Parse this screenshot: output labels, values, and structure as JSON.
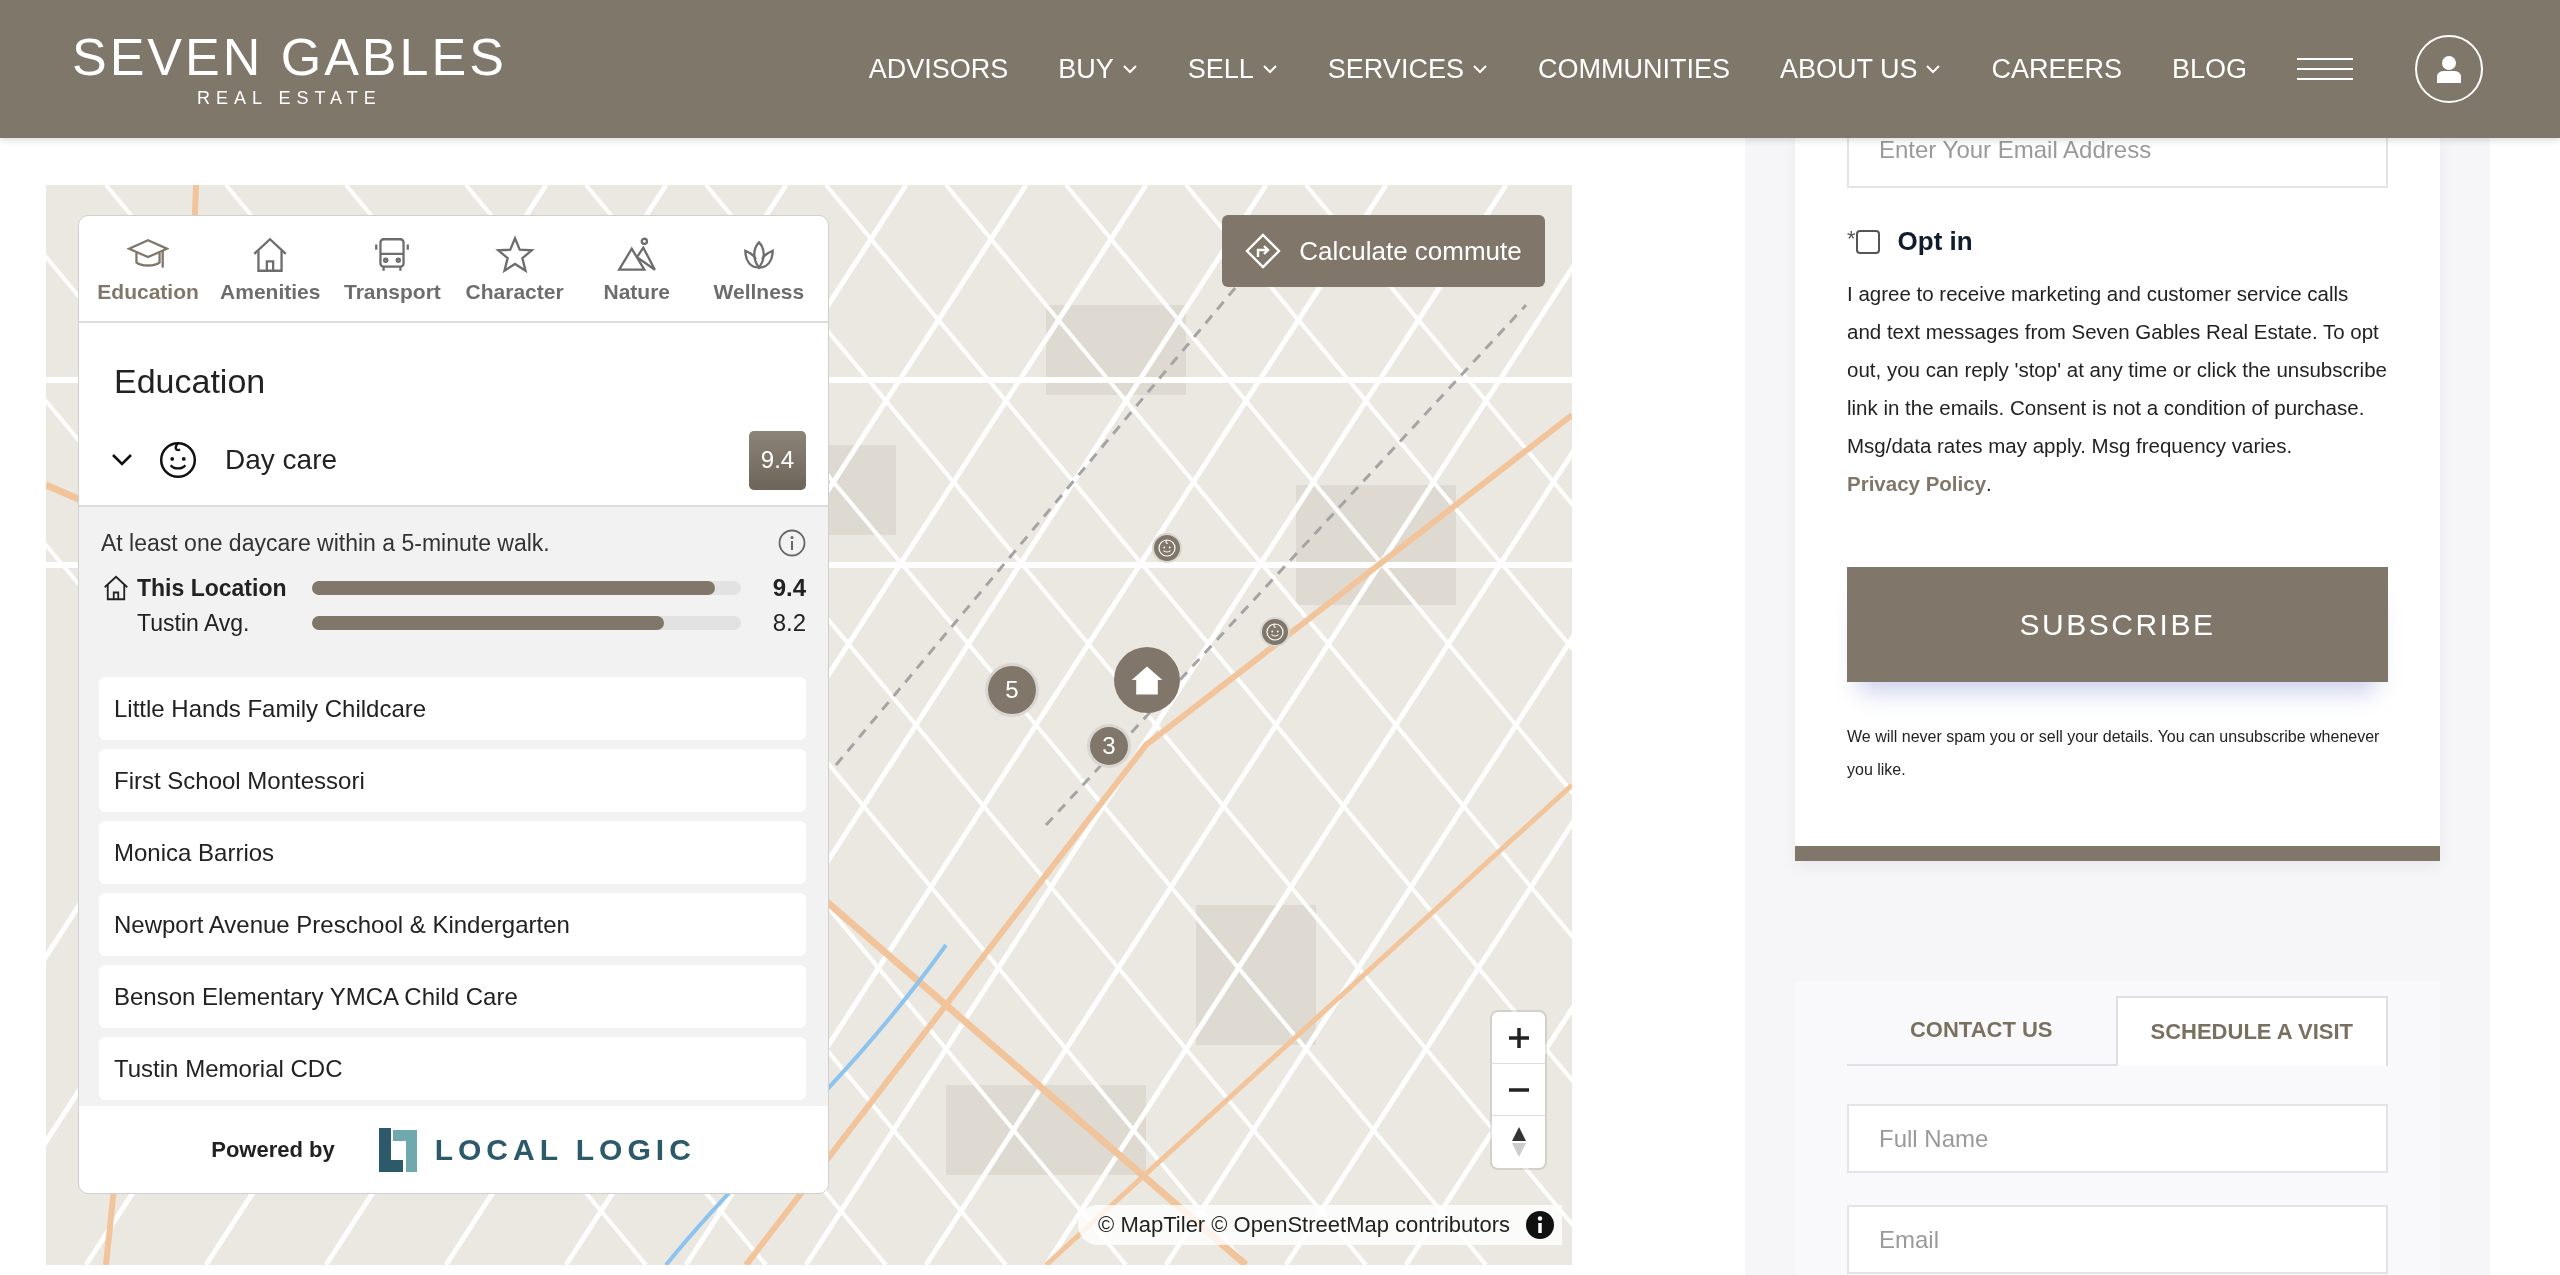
{
  "header": {
    "logo": {
      "name": "SEVEN GABLES",
      "tagline": "REAL ESTATE"
    },
    "nav": [
      {
        "label": "ADVISORS",
        "dropdown": false
      },
      {
        "label": "BUY",
        "dropdown": true
      },
      {
        "label": "SELL",
        "dropdown": true
      },
      {
        "label": "SERVICES",
        "dropdown": true
      },
      {
        "label": "COMMUNITIES",
        "dropdown": false
      },
      {
        "label": "ABOUT US",
        "dropdown": true
      },
      {
        "label": "CAREERS",
        "dropdown": false
      },
      {
        "label": "BLOG",
        "dropdown": false
      }
    ]
  },
  "map": {
    "commute_button": "Calculate commute",
    "markers": [
      {
        "kind": "cluster",
        "count": "5"
      },
      {
        "kind": "home"
      },
      {
        "kind": "cluster",
        "count": "3"
      },
      {
        "kind": "poi"
      },
      {
        "kind": "poi"
      }
    ],
    "attribution": "© MapTiler © OpenStreetMap contributors"
  },
  "panel": {
    "tabs": [
      {
        "label": "Education",
        "selected": true
      },
      {
        "label": "Amenities",
        "selected": false
      },
      {
        "label": "Transport",
        "selected": false
      },
      {
        "label": "Character",
        "selected": false
      },
      {
        "label": "Nature",
        "selected": false
      },
      {
        "label": "Wellness",
        "selected": false
      }
    ],
    "heading": "Education",
    "category": {
      "label": "Day care",
      "score": "9.4",
      "expanded": true
    },
    "description": "At least one daycare within a 5-minute walk.",
    "comparisons": [
      {
        "kind": "location",
        "label": "This Location",
        "level": 0.94,
        "value": "9.4"
      },
      {
        "kind": "average",
        "label": "Tustin Avg.",
        "level": 0.82,
        "value": "8.2"
      }
    ],
    "places": [
      "Little Hands Family Childcare",
      "First School Montessori",
      "Monica Barrios",
      "Newport Avenue Preschool & Kindergarten",
      "Benson Elementary YMCA Child Care",
      "Tustin Memorial CDC"
    ],
    "footer": {
      "powered_by": "Powered by",
      "brand": "LOCAL LOGIC"
    }
  },
  "newsletter": {
    "email_placeholder": "Enter Your Email Address",
    "opt_in": {
      "required_mark": "*",
      "label": "Opt in",
      "checked": false
    },
    "consent": {
      "text": "I agree to receive marketing and customer service calls and text messages from Seven Gables Real Estate. To opt out, you can reply 'stop' at any time or click the unsubscribe link in the emails. Consent is not a condition of purchase. Msg/data rates may apply. Msg frequency varies. ",
      "link": "Privacy Policy",
      "after": "."
    },
    "subscribe": "SUBSCRIBE",
    "note": "We will never spam you or sell your details. You can unsubscribe whenever you like."
  },
  "contact": {
    "tabs": [
      {
        "label": "CONTACT US",
        "selected": false
      },
      {
        "label": "SCHEDULE A VISIT",
        "selected": true
      }
    ],
    "fields": [
      {
        "placeholder": "Full Name"
      },
      {
        "placeholder": "Email"
      }
    ]
  }
}
